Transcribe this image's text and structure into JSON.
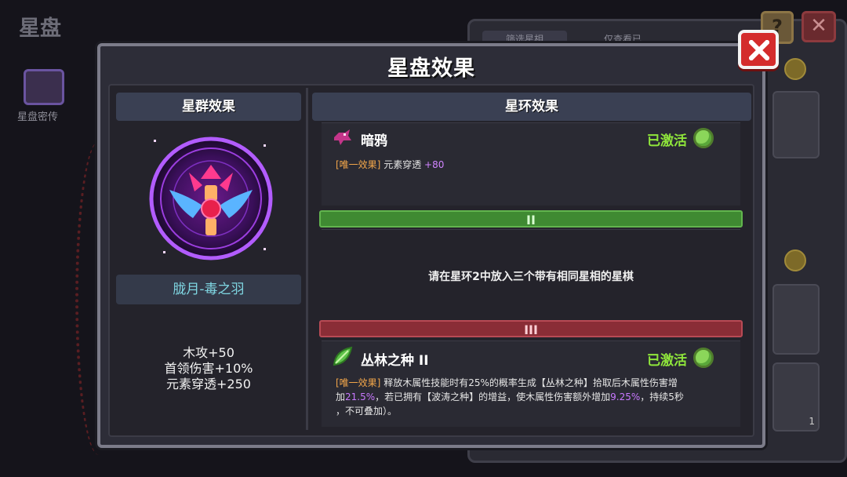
{
  "background": {
    "title": "星盘",
    "skill_label": "星盘密传",
    "tab_a": "筛选星相",
    "tab_b": "仅查看已",
    "help_glyph": "?",
    "close_glyph": "✕",
    "slot_count": "1"
  },
  "modal": {
    "title": "星盘效果",
    "left": {
      "header": "星群效果",
      "constellation_name": "胧月-毒之羽",
      "stats": [
        "木攻+50",
        "首领伤害+10%",
        "元素穿透+250"
      ]
    },
    "right": {
      "header": "星环效果",
      "ring1": {
        "name": "暗鸦",
        "status": "已激活",
        "tag": "[唯一效果]",
        "effect_text": "元素穿透",
        "effect_value": "+80"
      },
      "tier2": {
        "label": "II",
        "hint": "请在星环2中放入三个带有相同星相的星棋"
      },
      "tier3": {
        "label": "III",
        "name": "丛林之种 II",
        "status": "已激活",
        "tag": "[唯一效果]",
        "desc_1": "释放木属性技能时有25%的概率生成【丛林之种】拾取后木属性伤害增",
        "desc_2a": "加",
        "desc_2b": "21.5%",
        "desc_2c": "，若已拥有【波涛之种】的增益，使木属性伤害额外增加",
        "desc_2d": "9.25%",
        "desc_2e": "，持续5秒",
        "desc_3": "，不可叠加）。"
      }
    }
  },
  "colors": {
    "activated": "#8fe63b",
    "tier2": "#3f8a32",
    "tier3": "#8a2d36",
    "close_button": "#d42c2c",
    "constellation_name": "#7fd6e2"
  },
  "icons": [
    "raven-icon",
    "leaf-seed-icon",
    "close-icon",
    "constellation-emblem-icon"
  ]
}
